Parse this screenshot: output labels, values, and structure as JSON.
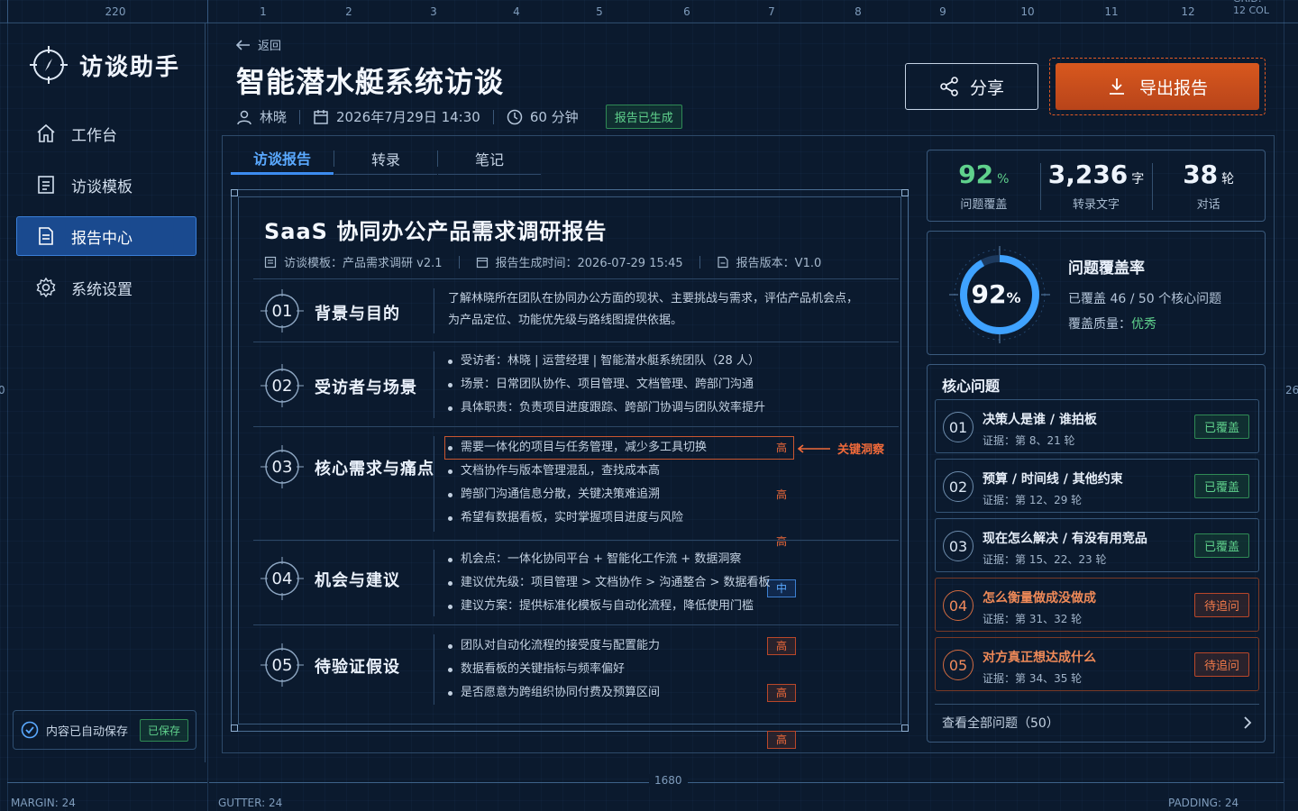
{
  "ruler": {
    "top_left": "220",
    "cols": [
      "1",
      "2",
      "3",
      "4",
      "5",
      "6",
      "7",
      "8",
      "9",
      "10",
      "11",
      "12"
    ],
    "grid_label": "GRID: 12 COL",
    "side_left": "0",
    "side_right": "26",
    "bottom_width": "1680",
    "margin": "MARGIN: 24",
    "gutter": "GUTTER: 24",
    "padding": "PADDING: 24"
  },
  "app": {
    "name": "访谈助手",
    "logo_icon": "crosshair-compass-icon"
  },
  "nav": [
    {
      "label": "工作台",
      "icon": "home-icon",
      "active": false
    },
    {
      "label": "访谈模板",
      "icon": "document-icon",
      "active": false
    },
    {
      "label": "报告中心",
      "icon": "report-icon",
      "active": true
    },
    {
      "label": "系统设置",
      "icon": "gear-icon",
      "active": false
    }
  ],
  "autosave": {
    "text": "内容已自动保存",
    "badge": "已保存"
  },
  "header": {
    "back": "返回",
    "title": "智能潜水艇系统访谈",
    "interviewee": "林晓",
    "datetime": "2026年7月29日 14:30",
    "duration": "60 分钟",
    "status": "报告已生成",
    "share": "分享",
    "export": "导出报告"
  },
  "tabs": [
    {
      "label": "访谈报告",
      "active": true
    },
    {
      "label": "转录",
      "active": false
    },
    {
      "label": "笔记",
      "active": false
    }
  ],
  "report": {
    "title": "SaaS 协同办公产品需求调研报告",
    "template": "访谈模板：产品需求调研 v2.1",
    "generated": "报告生成时间：2026-07-29 15:45",
    "version": "报告版本：V1.0",
    "sections": [
      {
        "num": "01",
        "title": "背景与目的",
        "text": [
          "了解林晓所在团队在协同办公方面的现状、主要挑战与需求，评估产品机会点，",
          "为产品定位、功能优先级与路线图提供依据。"
        ]
      },
      {
        "num": "02",
        "title": "受访者与场景",
        "bullets": [
          "受访者：林晓 | 运营经理 | 智能潜水艇系统团队（28 人）",
          "场景：日常团队协作、项目管理、文档管理、跨部门沟通",
          "具体职责：负责项目进度跟踪、跨部门协调与团队效率提升"
        ]
      },
      {
        "num": "03",
        "title": "核心需求与痛点",
        "bullets": [
          {
            "text": "需要一体化的项目与任务管理，减少多工具切换",
            "level": "高"
          },
          {
            "text": "文档协作与版本管理混乱，查找成本高",
            "level": "高"
          },
          {
            "text": "跨部门沟通信息分散，关键决策难追溯",
            "level": "高"
          },
          {
            "text": "希望有数据看板，实时掌握项目进度与风险",
            "level": "中"
          }
        ],
        "insight": "关键洞察"
      },
      {
        "num": "04",
        "title": "机会与建议",
        "bullets": [
          "机会点：一体化协同平台 + 智能化工作流 + 数据洞察",
          "建议优先级：项目管理 > 文档协作 > 沟通整合 > 数据看板",
          "建议方案：提供标准化模板与自动化流程，降低使用门槛"
        ]
      },
      {
        "num": "05",
        "title": "待验证假设",
        "bullets": [
          {
            "text": "团队对自动化流程的接受度与配置能力",
            "level": "高"
          },
          {
            "text": "数据看板的关键指标与频率偏好",
            "level": "高"
          },
          {
            "text": "是否愿意为跨组织协同付费及预算区间",
            "level": "高"
          }
        ]
      }
    ]
  },
  "stats": [
    {
      "value": "92",
      "unit": "%",
      "label": "问题覆盖"
    },
    {
      "value": "3,236",
      "unit": "字",
      "label": "转录文字"
    },
    {
      "value": "38",
      "unit": "轮",
      "label": "对话"
    }
  ],
  "coverage": {
    "value": "92",
    "unit": "%",
    "fraction": 0.92,
    "title": "问题覆盖率",
    "covered": "已覆盖  46  /  50  个核心问题",
    "quality_label": "覆盖质量：",
    "quality": "优秀"
  },
  "core": {
    "title": "核心问题",
    "items": [
      {
        "num": "01",
        "title": "决策人是谁 / 谁拍板",
        "evidence": "证据：第 8、21 轮",
        "status": "已覆盖",
        "pending": false
      },
      {
        "num": "02",
        "title": "预算 / 时间线 / 其他约束",
        "evidence": "证据：第 12、29 轮",
        "status": "已覆盖",
        "pending": false
      },
      {
        "num": "03",
        "title": "现在怎么解决 / 有没有用竞品",
        "evidence": "证据：第 15、22、23 轮",
        "status": "已覆盖",
        "pending": false
      },
      {
        "num": "04",
        "title": "怎么衡量做成没做成",
        "evidence": "证据：第 31、32 轮",
        "status": "待追问",
        "pending": true
      },
      {
        "num": "05",
        "title": "对方真正想达成什么",
        "evidence": "证据：第 34、35 轮",
        "status": "待追问",
        "pending": true
      }
    ],
    "view_all": "查看全部问题（50）"
  },
  "colors": {
    "accent": "#3d8cf0",
    "export": "#d8581e",
    "ok": "#5fd18c",
    "warn": "#f06a3a"
  }
}
